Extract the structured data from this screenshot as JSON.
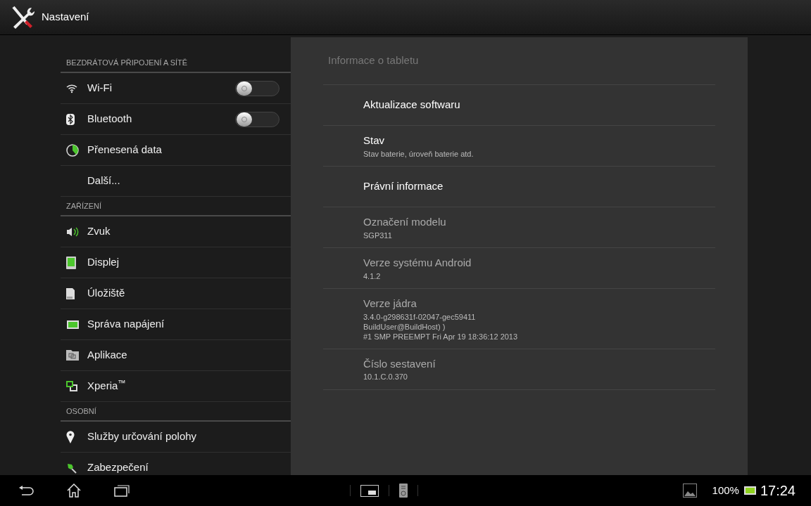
{
  "action_bar": {
    "title": "Nastavení"
  },
  "sidebar": [
    {
      "kind": "section",
      "label": "BEZDRÁTOVÁ PŘIPOJENÍ A SÍTĚ"
    },
    {
      "kind": "item",
      "label": "Wi-Fi",
      "toggle": {
        "on": false
      }
    },
    {
      "kind": "item",
      "label": "Bluetooth",
      "toggle": {
        "on": false
      }
    },
    {
      "kind": "item",
      "label": "Přenesená data"
    },
    {
      "kind": "item",
      "label": "Další..."
    },
    {
      "kind": "section",
      "label": "ZAŘÍZENÍ"
    },
    {
      "kind": "item",
      "label": "Zvuk"
    },
    {
      "kind": "item",
      "label": "Displej"
    },
    {
      "kind": "item",
      "label": "Úložiště"
    },
    {
      "kind": "item",
      "label": "Správa napájení"
    },
    {
      "kind": "item",
      "label": "Aplikace"
    },
    {
      "kind": "item",
      "label": "Xperia$^{™}$"
    },
    {
      "kind": "section",
      "label": "OSOBNÍ"
    },
    {
      "kind": "item",
      "label": "Služby určování polohy"
    },
    {
      "kind": "item",
      "label": "Zabezpečení"
    }
  ],
  "detail": {
    "title": "Informace o tabletu",
    "items": [
      {
        "title": "Aktualizace softwaru",
        "enabled": true
      },
      {
        "title": "Stav",
        "summary": [
          "Stav baterie, úroveň baterie atd."
        ],
        "enabled": true
      },
      {
        "title": "Právní informace",
        "enabled": true
      },
      {
        "title": "Označení modelu",
        "summary": [
          "SGP311"
        ],
        "enabled": false
      },
      {
        "title": "Verze systému Android",
        "summary": [
          "4.1.2"
        ],
        "enabled": false
      },
      {
        "title": "Verze jádra",
        "summary": [
          "3.4.0-g298631f-02047-gec59411",
          "BuildUser@BuildHost) )",
          "#1 SMP PREEMPT Fri Apr 19 18:36:12 2013"
        ],
        "enabled": false
      },
      {
        "title": "Číslo sestavení",
        "summary": [
          "10.1.C.0.370"
        ],
        "enabled": false
      }
    ]
  },
  "status_bar": {
    "battery": "100%",
    "time": "17:24"
  }
}
